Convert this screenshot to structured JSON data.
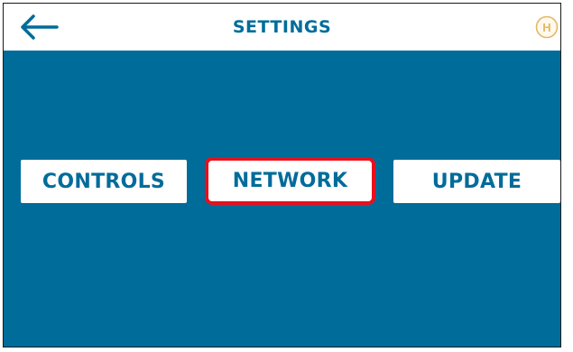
{
  "header": {
    "title": "SETTINGS",
    "back_icon": "arrow-left-icon",
    "home_icon": "h-circle-icon",
    "home_icon_letter": "H"
  },
  "menu": {
    "buttons": [
      {
        "label": "CONTROLS",
        "highlighted": false
      },
      {
        "label": "NETWORK",
        "highlighted": true
      },
      {
        "label": "UPDATE",
        "highlighted": false
      }
    ]
  },
  "colors": {
    "primary": "#006c9a",
    "background": "#006c9a",
    "header_bg": "#ffffff",
    "button_bg": "#ffffff",
    "highlight": "#e8101c",
    "home_icon": "#e3b865"
  }
}
